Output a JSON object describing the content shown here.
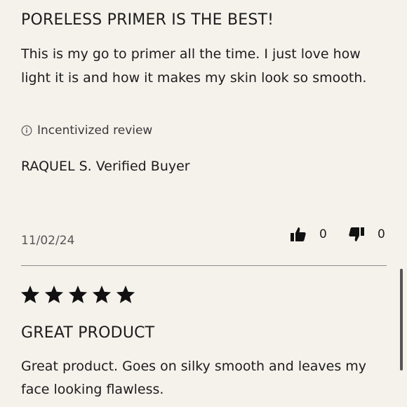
{
  "review1": {
    "title": "PORELESS PRIMER IS THE BEST!",
    "body": "This is my go to primer all the time. I just love how light it is and how it makes my skin look so smooth.",
    "incentivized_label": "Incentivized review",
    "reviewer": "RAQUEL S. Verified Buyer",
    "date": "11/02/24",
    "helpful_count": "0",
    "unhelpful_count": "0",
    "icons": [
      "info-icon",
      "thumbs-up-icon",
      "thumbs-down-icon"
    ]
  },
  "review2": {
    "rating": 5,
    "title": "GREAT PRODUCT",
    "body": "Great product. Goes on silky smooth and leaves my face looking flawless.",
    "icons": [
      "star-icon"
    ]
  },
  "colors": {
    "background": "#f5f2ec",
    "text": "#1c1c1c",
    "divider": "#8c8c8c"
  }
}
